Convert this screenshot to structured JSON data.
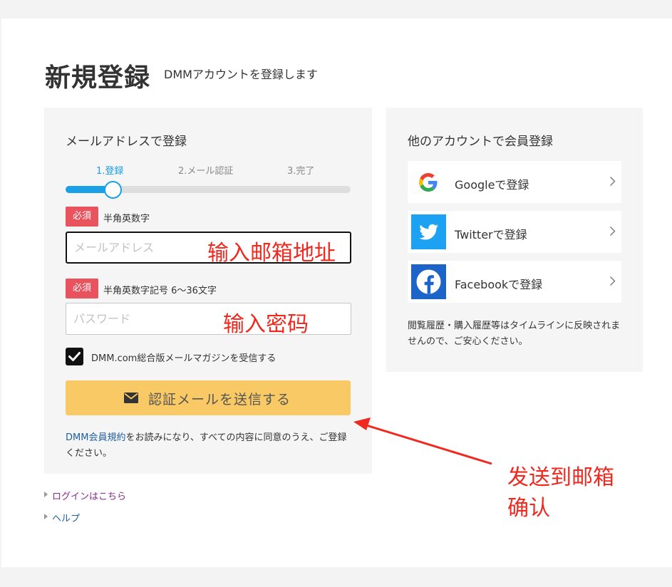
{
  "header": {
    "title": "新規登録",
    "subtitle": "DMMアカウントを登録します"
  },
  "email_signup": {
    "heading": "メールアドレスで登録",
    "steps": [
      {
        "label": "1.登録",
        "active": true
      },
      {
        "label": "2.メール認証",
        "active": false
      },
      {
        "label": "3.完了",
        "active": false
      }
    ],
    "progress_fraction": 0.17,
    "email_field": {
      "badge": "必須",
      "hint": "半角英数字",
      "placeholder": "メールアドレス",
      "value": ""
    },
    "password_field": {
      "badge": "必須",
      "hint": "半角英数字記号 6〜36文字",
      "placeholder": "パスワード",
      "value": ""
    },
    "newsletter_checkbox": {
      "label": "DMM.com総合版メールマガジンを受信する",
      "checked": true
    },
    "submit_button": {
      "label": "認証メールを送信する",
      "icon": "envelope-icon"
    },
    "terms": {
      "link_text": "DMM会員規約",
      "text": "をお読みになり、すべての内容に同意のうえ、ご登録ください。"
    }
  },
  "footer_links": [
    {
      "label": "ログインはこちら",
      "color": "#8a2a8a"
    },
    {
      "label": "ヘルプ",
      "color": "#1f5e9e"
    }
  ],
  "social_signup": {
    "heading": "他のアカウントで会員登録",
    "buttons": [
      {
        "label": "Googleで登録",
        "icon": "google-icon"
      },
      {
        "label": "Twitterで登録",
        "icon": "twitter-icon",
        "color": "#1da1f2"
      },
      {
        "label": "Facebookで登録",
        "icon": "facebook-icon",
        "color": "#1877f2"
      }
    ],
    "note": "閲覧履歴・購入履歴等はタイムラインに反映されませんので、ご安心ください。"
  },
  "annotations": {
    "email": "输入邮箱地址",
    "password": "输入密码",
    "send_line1": "发送到邮箱",
    "send_line2": "确认"
  },
  "colors": {
    "accent": "#1aa0e6",
    "required_badge": "#e8535e",
    "submit_button": "#f8c964",
    "annotation": "#f0281e"
  }
}
